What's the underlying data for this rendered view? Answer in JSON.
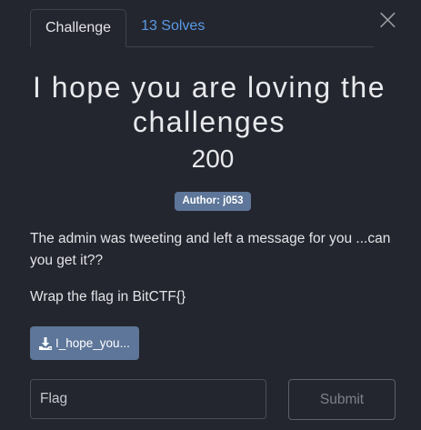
{
  "tabs": [
    {
      "label": "Challenge"
    },
    {
      "label": "13 Solves"
    }
  ],
  "close_icon": "close-icon",
  "challenge": {
    "title": "I hope you are loving the challenges",
    "points": "200",
    "author": "Author: j053",
    "description": [
      "The admin was tweeting and left a message for you ...can you get it??",
      "Wrap the flag in BitCTF{}"
    ],
    "file": {
      "icon": "download-icon",
      "label": "I_hope_you..."
    }
  },
  "form": {
    "flag_placeholder": "Flag",
    "flag_value": "",
    "submit_label": "Submit"
  },
  "colors": {
    "background": "#24262f",
    "accent_link": "#5a9be6",
    "badge": "#5d7699"
  }
}
